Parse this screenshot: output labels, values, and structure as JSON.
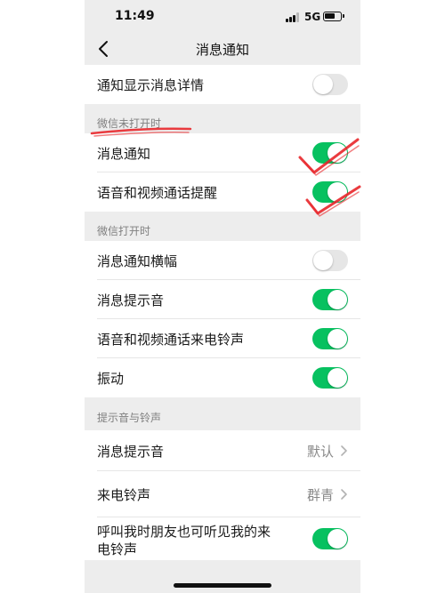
{
  "status_bar": {
    "time": "11:49",
    "network": "5G",
    "battery_level": 0.75
  },
  "nav": {
    "title": "消息通知"
  },
  "top_row": {
    "label": "通知显示消息详情",
    "enabled": false
  },
  "sections": {
    "closed": {
      "header": "微信未打开时",
      "items": [
        {
          "label": "消息通知",
          "enabled": true
        },
        {
          "label": "语音和视频通话提醒",
          "enabled": true
        }
      ]
    },
    "open": {
      "header": "微信打开时",
      "items": [
        {
          "label": "消息通知横幅",
          "enabled": false
        },
        {
          "label": "消息提示音",
          "enabled": true
        },
        {
          "label": "语音和视频通话来电铃声",
          "enabled": true
        },
        {
          "label": "振动",
          "enabled": true
        }
      ]
    },
    "sounds": {
      "header": "提示音与铃声",
      "items": [
        {
          "label": "消息提示音",
          "value": "默认"
        },
        {
          "label": "来电铃声",
          "value": "群青"
        },
        {
          "label_line1": "呼叫我时朋友也可听见我的来",
          "label_line2": "电铃声",
          "enabled": true
        }
      ]
    }
  },
  "colors": {
    "switch_on": "#07c160",
    "switch_off": "#e6e6e6",
    "annotation": "#e8262a"
  },
  "icons": [
    "back-chevron-icon",
    "signal-icon",
    "battery-icon",
    "chevron-right-icon"
  ]
}
